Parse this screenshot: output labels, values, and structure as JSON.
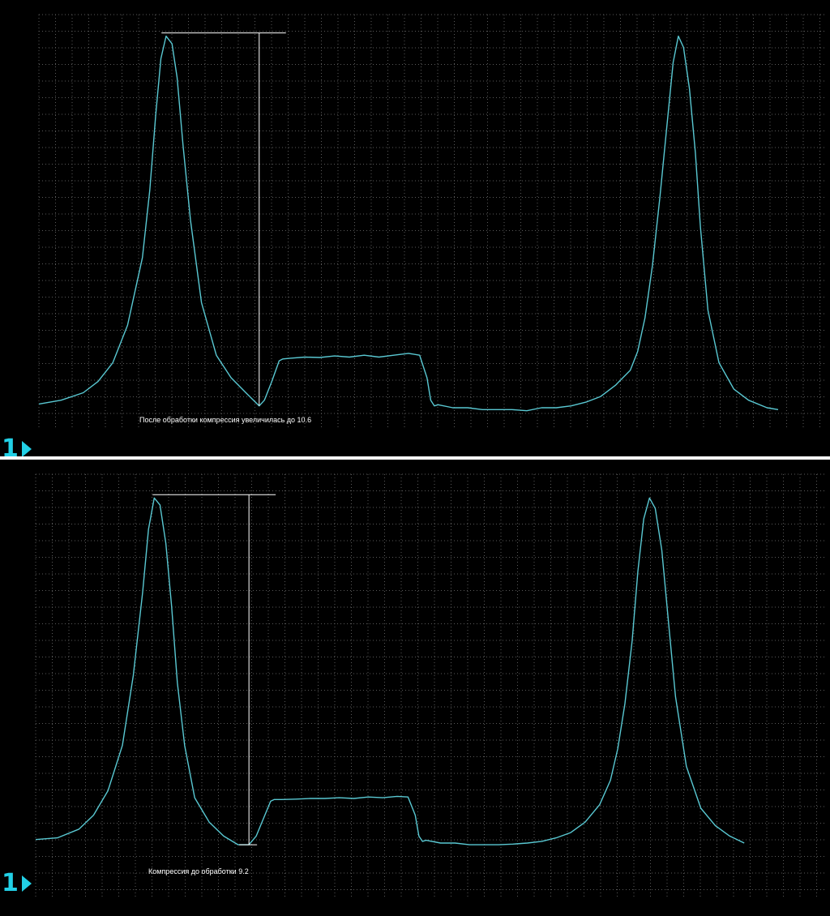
{
  "colors": {
    "background": "#000000",
    "grid": "#5a5a5a",
    "trace": "#59c8d2",
    "marker": "#ffffff",
    "channel": "#22d0e6",
    "divider": "#ffffff"
  },
  "panels": [
    {
      "caption": "После обработки компрессия увеличилась до 10.6",
      "channel": "1",
      "icon": "channel-arrow-icon"
    },
    {
      "caption": "Компрессия до обработки 9.2",
      "channel": "1",
      "icon": "channel-arrow-icon"
    }
  ],
  "chart_data": [
    {
      "type": "line",
      "grid": true,
      "x_range": [
        0,
        100
      ],
      "y_range": [
        0,
        100
      ],
      "series": [
        {
          "x": [
            0,
            3,
            6,
            8,
            10,
            12,
            14,
            15,
            15.8,
            16.5,
            17.2,
            18,
            18.7,
            19.5,
            20.5,
            22,
            24,
            26,
            28,
            29.8,
            30.5,
            31.5,
            32.5,
            33,
            34,
            36,
            38,
            40,
            42,
            44,
            46,
            48,
            50,
            51.5,
            52.5,
            53,
            53.5,
            54,
            56,
            58,
            60,
            62,
            64,
            66,
            68,
            70,
            72,
            74,
            76,
            78,
            80,
            81,
            82,
            83,
            84,
            85,
            85.8,
            86.5,
            87.2,
            88,
            88.8,
            89.5,
            90.5,
            92,
            94,
            96,
            98.5,
            100
          ],
          "y": [
            1,
            2,
            4,
            7,
            12,
            22,
            40,
            58,
            78,
            93,
            99,
            97,
            88,
            70,
            50,
            28,
            14,
            8,
            4,
            0.5,
            2,
            7,
            12.5,
            13,
            13.2,
            13.5,
            13.4,
            13.8,
            13.5,
            14,
            13.5,
            14,
            14.5,
            14,
            8,
            2,
            0.5,
            0.8,
            0,
            0,
            -0.5,
            -0.5,
            -0.5,
            -0.8,
            0,
            0,
            0.5,
            1.5,
            3,
            6,
            10,
            15,
            24,
            38,
            56,
            76,
            92,
            99,
            96,
            85,
            68,
            48,
            26,
            12,
            5,
            2,
            0,
            -0.5
          ]
        }
      ],
      "annotation": {
        "peak_x": 16.8,
        "peak_y": 99,
        "valley_x": 29.8,
        "valley_y": 0.5,
        "label": "10.6"
      }
    },
    {
      "type": "line",
      "grid": true,
      "x_range": [
        0,
        100
      ],
      "y_range": [
        0,
        100
      ],
      "series": [
        {
          "x": [
            0,
            3,
            6,
            8,
            10,
            12,
            13.5,
            14.8,
            15.6,
            16.4,
            17.2,
            18,
            18.8,
            19.6,
            20.6,
            22,
            24,
            26,
            28,
            29.5,
            30.5,
            31.5,
            32.5,
            33,
            34,
            36,
            38,
            40,
            42,
            44,
            46,
            48,
            50,
            51.5,
            52.5,
            53,
            53.5,
            54,
            56,
            58,
            60,
            62,
            64,
            66,
            68,
            70,
            72,
            74,
            76,
            78,
            79.5,
            80.5,
            81.5,
            82.5,
            83.3,
            84.1,
            84.9,
            85.7,
            86.6,
            87.5,
            88.5,
            90,
            92,
            94,
            96,
            98
          ],
          "y": [
            1,
            1.5,
            4,
            8,
            15,
            28,
            48,
            72,
            90,
            99,
            97,
            86,
            68,
            46,
            28,
            13,
            6,
            2,
            -0.5,
            -0.5,
            2,
            7,
            12,
            12.5,
            12.5,
            12.6,
            12.8,
            12.8,
            13,
            12.8,
            13.2,
            13,
            13.4,
            13.2,
            8,
            2,
            0.5,
            0.8,
            0,
            0,
            -0.5,
            -0.5,
            -0.5,
            -0.3,
            0,
            0.5,
            1.5,
            3,
            6,
            11,
            18,
            27,
            40,
            58,
            78,
            93,
            99,
            96,
            84,
            64,
            42,
            22,
            10,
            5,
            2,
            0
          ]
        }
      ],
      "annotation": {
        "peak_x": 16.4,
        "peak_y": 99,
        "valley_x": 29.5,
        "valley_y": -0.5,
        "label": "9.2"
      }
    }
  ]
}
